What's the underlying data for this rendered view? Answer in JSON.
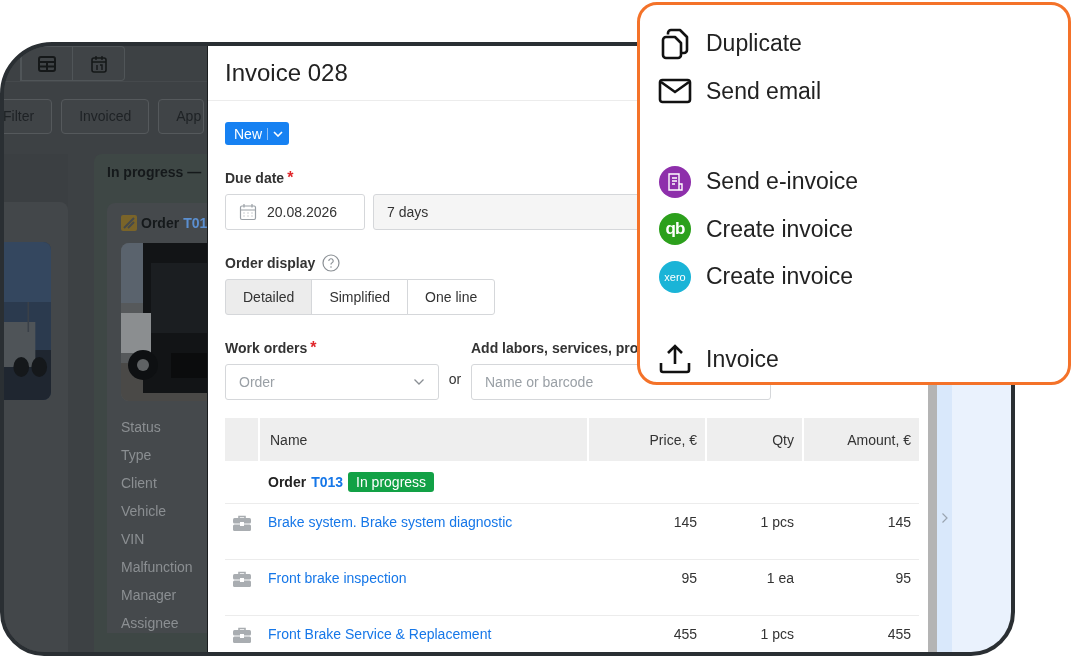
{
  "background_app": {
    "filter_buttons": [
      "Filter",
      "Invoiced",
      "App"
    ],
    "column": {
      "title": "In progress —",
      "card": {
        "title": "Order",
        "number": "T01",
        "fields": [
          "Status",
          "Type",
          "Client",
          "Vehicle",
          "VIN",
          "Malfunction",
          "Manager",
          "Assignee"
        ]
      }
    }
  },
  "invoice": {
    "title": "Invoice 028",
    "status_button": "New",
    "due_date": {
      "label": "Due date",
      "required_mark": "*",
      "date": "20.08.2026",
      "term": "7 days"
    },
    "order_display": {
      "label": "Order display",
      "options": [
        {
          "label": "Detailed",
          "selected": true
        },
        {
          "label": "Simplified",
          "selected": false
        },
        {
          "label": "One line",
          "selected": false
        }
      ]
    },
    "work_orders": {
      "label": "Work orders",
      "required_mark": "*",
      "placeholder": "Order"
    },
    "separator": "or",
    "add_items": {
      "label": "Add labors, services, pro",
      "placeholder": "Name or barcode"
    },
    "table": {
      "columns": [
        "Name",
        "Price, €",
        "Qty",
        "Amount, €"
      ],
      "group": {
        "label": "Order",
        "number": "T013",
        "status": "In progress"
      },
      "rows": [
        {
          "name": "Brake system. Brake system diagnostic",
          "price": "145",
          "qty": "1 pcs",
          "amount": "145"
        },
        {
          "name": "Front brake inspection",
          "price": "95",
          "qty": "1 ea",
          "amount": "95"
        },
        {
          "name": "Front Brake Service & Replacement",
          "price": "455",
          "qty": "1 pcs",
          "amount": "455"
        }
      ]
    }
  },
  "menu": {
    "sections": [
      [
        {
          "label": "Duplicate",
          "kind": "icon"
        },
        {
          "label": "Send email",
          "kind": "icon"
        }
      ],
      [
        {
          "label": "Send e-invoice",
          "kind": "badge",
          "color": "#8e2fab"
        },
        {
          "label": "Create invoice",
          "kind": "logo",
          "color": "#2ca01c",
          "logo_text": "qb"
        },
        {
          "label": "Create invoice",
          "kind": "logo",
          "color": "#1ab4d7",
          "logo_text": "xero"
        }
      ],
      [
        {
          "label": "Invoice",
          "kind": "icon"
        }
      ]
    ]
  }
}
